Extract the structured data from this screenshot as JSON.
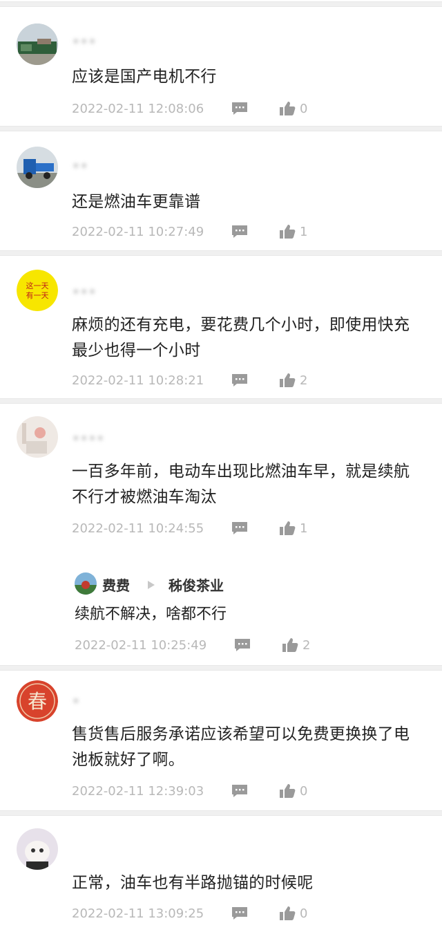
{
  "comments": [
    {
      "username": "•••",
      "text": "应该是国产电机不行",
      "timestamp": "2022-02-11 12:08:06",
      "likes": "0"
    },
    {
      "username": "••",
      "text": "还是燃油车更靠谱",
      "timestamp": "2022-02-11 10:27:49",
      "likes": "1"
    },
    {
      "username": "•••",
      "avatar_text": "这一天有一天",
      "text": "麻烦的还有充电，要花费几个小时，即使用快充最少也得一个小时",
      "timestamp": "2022-02-11 10:28:21",
      "likes": "2"
    },
    {
      "username": "••••",
      "text": "一百多年前，电动车出现比燃油车早，就是续航不行才被燃油车淘汰",
      "timestamp": "2022-02-11 10:24:55",
      "likes": "1",
      "reply": {
        "author": "费费",
        "target": "秭俊茶业",
        "text": "续航不解决，啥都不行",
        "timestamp": "2022-02-11 10:25:49",
        "likes": "2"
      }
    },
    {
      "username": "•",
      "avatar_text": "春",
      "text": "售货售后服务承诺应该希望可以免费更换换了电池板就好了啊。",
      "timestamp": "2022-02-11 12:39:03",
      "likes": "0"
    },
    {
      "username": "",
      "text": "正常，油车也有半路抛锚的时候呢",
      "timestamp": "2022-02-11 13:09:25",
      "likes": "0"
    }
  ],
  "colors": {
    "text": "#222222",
    "meta": "#b8b8b8",
    "divider": "#f0f0f0",
    "chun_red": "#d8432c",
    "yellow": "#f7e600"
  }
}
